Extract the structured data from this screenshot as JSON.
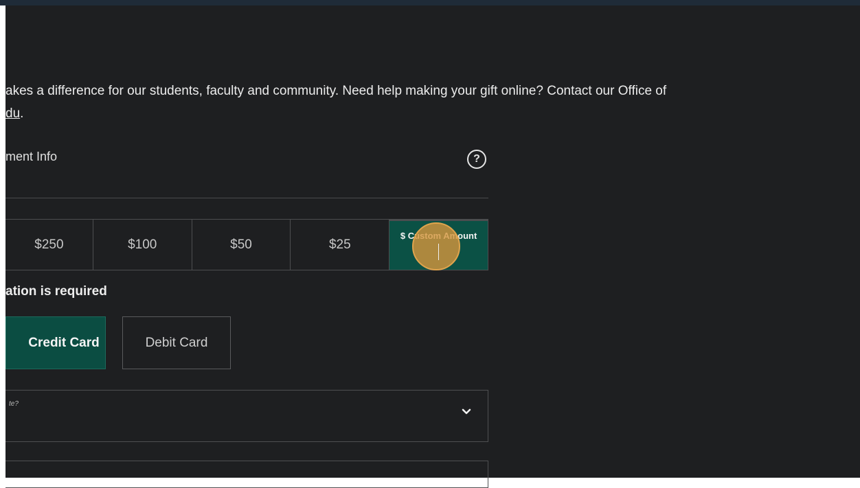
{
  "intro": {
    "line1": "akes a difference for our students, faculty and community. Need help making your gift online? Contact our Office of",
    "line2_link": "du",
    "line2_tail": "."
  },
  "payment_section": {
    "title": "ment Info",
    "help_icon": "question-circle-icon",
    "help_glyph": "?"
  },
  "amounts": {
    "options": [
      "$250",
      "$100",
      "$50",
      "$25"
    ],
    "custom_label": "$ Custom Amount",
    "selected": "$ Custom Amount"
  },
  "validation": {
    "message": "ation is required"
  },
  "payment_methods": {
    "credit_label": "Credit Card",
    "debit_label": "Debit Card",
    "selected": "Credit Card"
  },
  "dropdown": {
    "label": "te?",
    "icon": "chevron-down-icon"
  },
  "colors": {
    "background": "#1e1f21",
    "accent_green": "#0b5145",
    "text": "#e6e6e6",
    "cursor_highlight": "#d6963c"
  }
}
